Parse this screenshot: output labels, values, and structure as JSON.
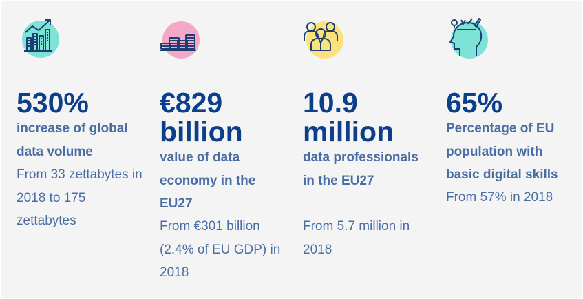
{
  "stats": [
    {
      "icon": "growth-chart-icon",
      "accent": "#7ee3d6",
      "value": "530%",
      "description": "increase of global data volume",
      "detail": "From 33 zettabytes in 2018 to 175 zettabytes"
    },
    {
      "icon": "coin-stacks-icon",
      "accent": "#f2a8c6",
      "value": "€829 billion",
      "description": "value of data economy in the EU27",
      "detail": "From €301 billion (2.4% of EU GDP) in 2018"
    },
    {
      "icon": "professionals-icon",
      "accent": "#fbe27c",
      "value": "10.9 million",
      "description": "data professionals in the EU27",
      "detail": "From 5.7 million in 2018"
    },
    {
      "icon": "digital-skills-head-icon",
      "accent": "#7ee3d6",
      "value": "65%",
      "description": "Percentage of EU population with basic digital skills",
      "detail": "From 57% in 2018"
    }
  ],
  "colors": {
    "value_text": "#0b3f8a",
    "body_text": "#4a6ea3",
    "background": "#f4f4f4",
    "icon_stroke": "#1c3f73"
  }
}
